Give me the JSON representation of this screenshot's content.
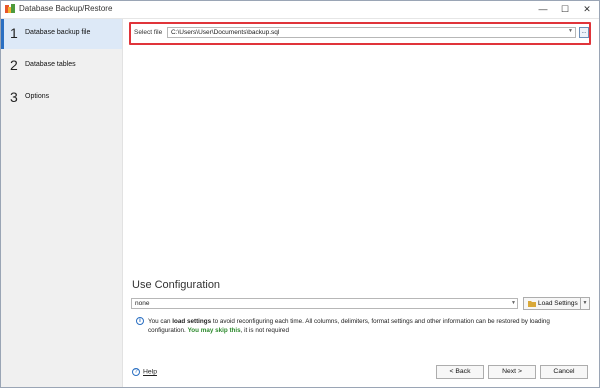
{
  "window": {
    "title": "Database Backup/Restore",
    "controls": {
      "minimize": "—",
      "maximize": "☐",
      "close": "✕"
    }
  },
  "sidebar": {
    "steps": [
      {
        "number": "1",
        "label": "Database backup file",
        "active": true
      },
      {
        "number": "2",
        "label": "Database tables",
        "active": false
      },
      {
        "number": "3",
        "label": "Options",
        "active": false
      }
    ]
  },
  "file": {
    "label": "Select file",
    "value": "C:\\Users\\User\\Documents\\backup.sql",
    "browse": "..."
  },
  "config": {
    "title": "Use Configuration",
    "value": "none",
    "load_label": "Load Settings",
    "info": {
      "prefix": "You can ",
      "bold": "load settings",
      "middle": " to avoid reconfiguring each time. All columns, delimiters, format settings and other information can be restored by loading configuration. ",
      "green": "You may skip this",
      "suffix": ", it is not required"
    }
  },
  "footer": {
    "help": "Help",
    "back": "< Back",
    "next": "Next >",
    "cancel": "Cancel"
  },
  "colors": {
    "accent": "#2a6fc2",
    "highlight_border": "#e0343a",
    "active_step_bg": "#dde9f7",
    "info_green": "#2d8a2d"
  }
}
